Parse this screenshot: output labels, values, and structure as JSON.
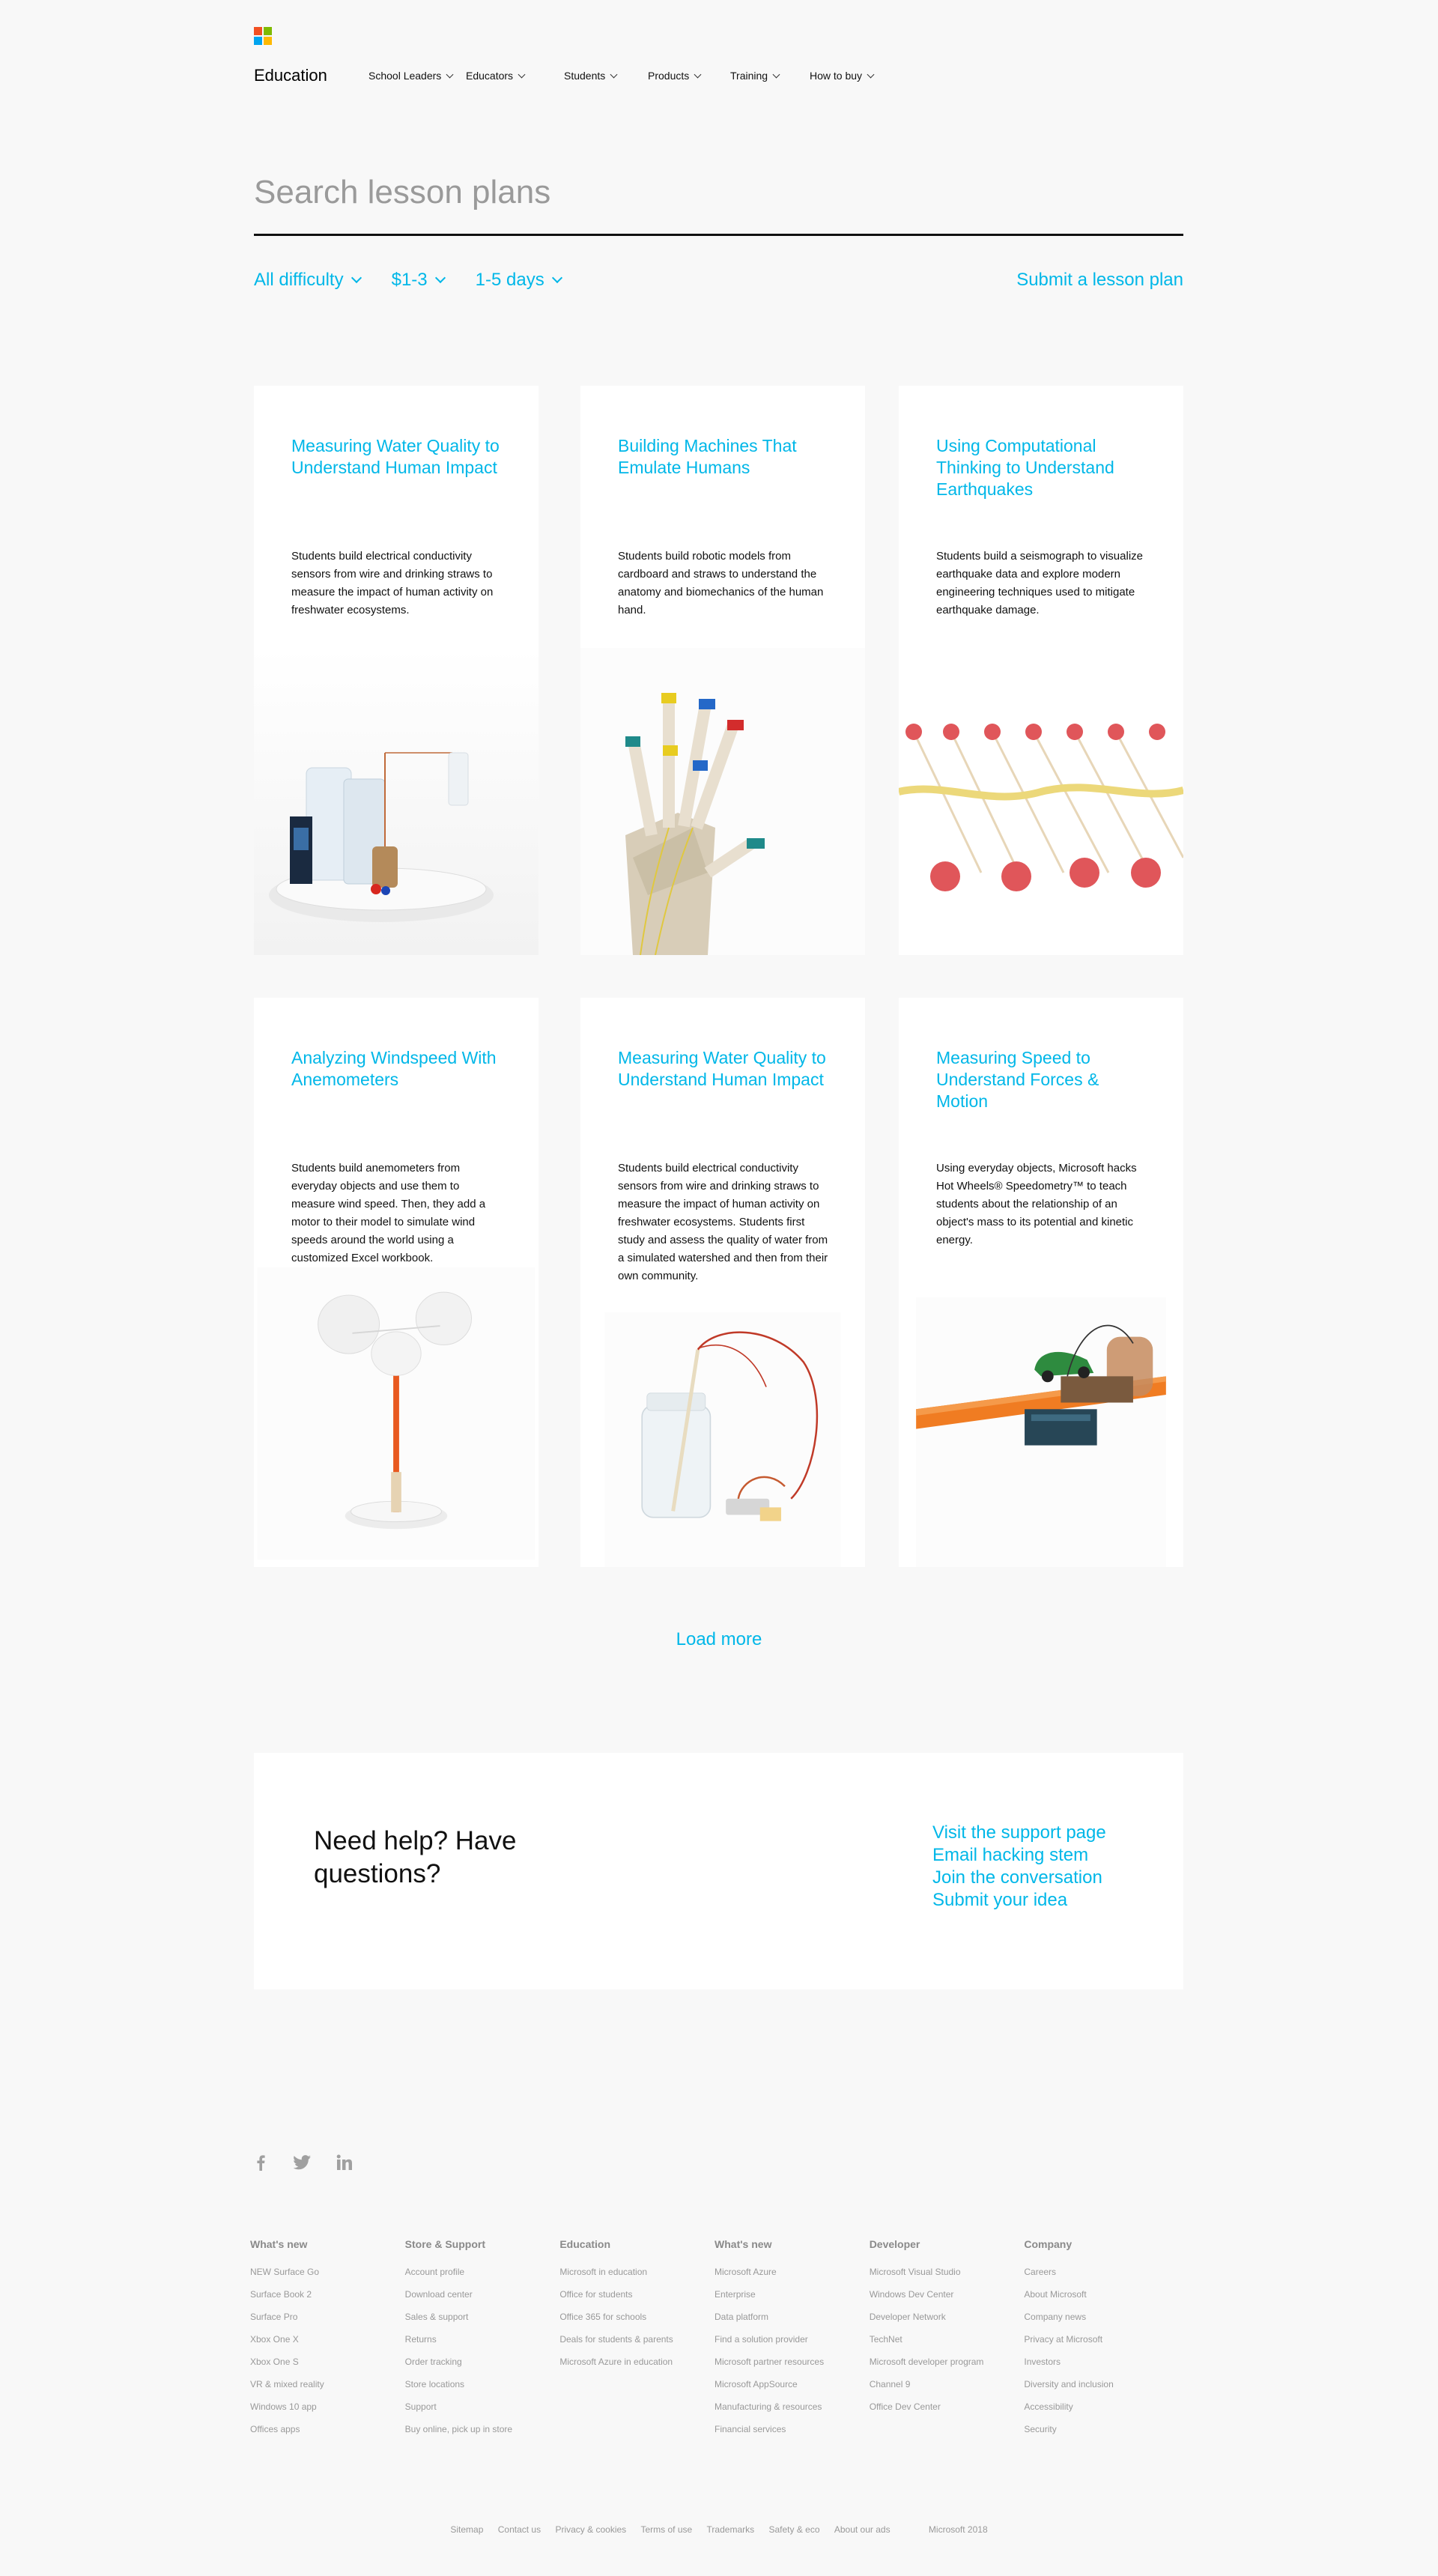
{
  "header": {
    "brand": "Education",
    "logo_colors": [
      "#f25022",
      "#7fba00",
      "#00a4ef",
      "#ffb900"
    ],
    "nav": [
      {
        "label": "School Leaders"
      },
      {
        "label": "Educators"
      },
      {
        "label": "Students"
      },
      {
        "label": "Products"
      },
      {
        "label": "Training"
      },
      {
        "label": "How to buy"
      }
    ]
  },
  "search": {
    "placeholder": "Search lesson plans",
    "value": ""
  },
  "filters": {
    "difficulty": "All difficulty",
    "cost": "$1-3",
    "duration": "1-5 days",
    "submit_label": "Submit a lesson plan"
  },
  "cards": [
    {
      "title": "Measuring Water Quality to Understand Human Impact",
      "description": "Students build electrical conductivity sensors from wire and drinking straws to measure the impact of human activity on freshwater ecosystems.",
      "image": "conductivity-sensor-photo"
    },
    {
      "title": "Building Machines That Emulate Humans",
      "description": "Students build robotic models from cardboard and straws to understand the anatomy and biomechanics of the human hand.",
      "image": "robotic-hand-photo"
    },
    {
      "title": "Using Computational Thinking to Understand Earthquakes",
      "description": "Students build a seismograph to visualize earthquake data and explore modern engineering techniques used to mitigate earthquake damage.",
      "image": "seismograph-photo"
    },
    {
      "title": "Analyzing Windspeed With Anemometers",
      "description": "Students build anemometers from everyday objects and use them to measure wind speed. Then, they add a motor to their model to simulate wind speeds around the world using a customized Excel workbook.",
      "image": "anemometer-photo"
    },
    {
      "title": "Measuring Water Quality to Understand Human Impact",
      "description": "Students build electrical conductivity sensors from wire and drinking straws to measure the impact of human activity on freshwater ecosystems. Students first study and assess the quality of water from a simulated watershed and then from their own community.",
      "image": "water-jar-sensor-photo"
    },
    {
      "title": "Measuring Speed to Understand Forces & Motion",
      "description": "Using everyday objects, Microsoft hacks Hot Wheels® Speedometry™ to teach students about the relationship of an object's mass to its potential and kinetic energy.",
      "image": "hot-wheels-track-photo"
    }
  ],
  "load_more": "Load more",
  "help": {
    "title": "Need help? Have questions?",
    "links": [
      "Visit the support page",
      "Email hacking stem",
      "Join the conversation",
      "Submit your idea"
    ]
  },
  "footer": {
    "social": [
      "facebook-icon",
      "twitter-icon",
      "linkedin-icon"
    ],
    "columns": [
      {
        "heading": "What's new",
        "links": [
          "NEW Surface Go",
          "Surface Book 2",
          "Surface Pro",
          "Xbox One X",
          "Xbox One S",
          "VR & mixed reality",
          "Windows 10 app",
          "Offices apps"
        ]
      },
      {
        "heading": "Store & Support",
        "links": [
          "Account profile",
          "Download center",
          "Sales & support",
          "Returns",
          "Order tracking",
          "Store locations",
          "Support",
          "Buy online, pick up in store"
        ]
      },
      {
        "heading": "Education",
        "links": [
          "Microsoft in education",
          "Office for students",
          "Office 365 for schools",
          "Deals for students & parents",
          "Microsoft Azure in education"
        ]
      },
      {
        "heading": "What's new",
        "links": [
          "Microsoft Azure",
          "Enterprise",
          "Data platform",
          "Find a solution provider",
          "Microsoft partner resources",
          "Microsoft AppSource",
          "Manufacturing & resources",
          "Financial services"
        ]
      },
      {
        "heading": "Developer",
        "links": [
          "Microsoft Visual Studio",
          "Windows Dev Center",
          "Developer Network",
          "TechNet",
          "Microsoft developer program",
          "Channel 9",
          "Office Dev Center"
        ]
      },
      {
        "heading": "Company",
        "links": [
          "Careers",
          "About Microsoft",
          "Company news",
          "Privacy at Microsoft",
          "Investors",
          "Diversity and inclusion",
          "Accessibility",
          "Security"
        ]
      }
    ],
    "legal": [
      "Sitemap",
      "Contact us",
      "Privacy & cookies",
      "Terms of use",
      "Trademarks",
      "Safety & eco",
      "About our ads"
    ],
    "copyright": "Microsoft 2018"
  }
}
